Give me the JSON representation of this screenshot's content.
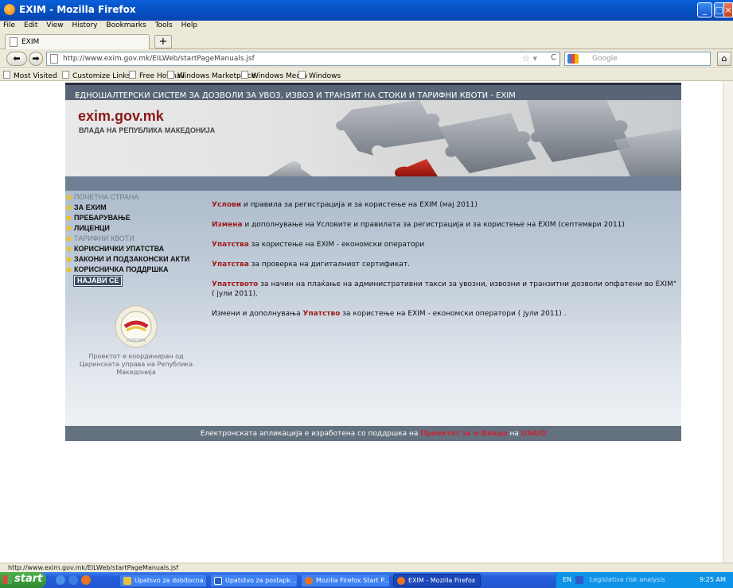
{
  "window": {
    "title": "EXIM - Mozilla Firefox"
  },
  "menu": [
    "File",
    "Edit",
    "View",
    "History",
    "Bookmarks",
    "Tools",
    "Help"
  ],
  "tab": {
    "label": "EXIM",
    "new_tab": "+"
  },
  "nav": {
    "url": "http://www.exim.gov.mk/EILWeb/startPageManuals.jsf",
    "search_placeholder": "Google"
  },
  "bookmarks": [
    "Most Visited",
    "Customize Links",
    "Free Hotmail",
    "Windows Marketplace",
    "Windows Media",
    "Windows"
  ],
  "site": {
    "top_title": "ЕДНОШАЛТЕРСКИ СИСТЕМ ЗА ДОЗВОЛИ ЗА УВОЗ, ИЗВОЗ И ТРАНЗИТ НА СТОКИ И ТАРИФНИ КВОТИ - EXIM",
    "logo": "exim.gov.mk",
    "logo_sub": "ВЛАДА НА РЕПУБЛИКА МАКЕДОНИЈА",
    "left_nav": [
      {
        "label": "ПОЧЕТНА СТРАНА",
        "style": "muted"
      },
      {
        "label": "ЗА ЕХИМ",
        "style": "dark"
      },
      {
        "label": "ПРЕБАРУВАЊЕ",
        "style": "dark"
      },
      {
        "label": "ЛИЦЕНЦИ",
        "style": "dark"
      },
      {
        "label": "ТАРИФНИ КВОТИ",
        "style": "muted"
      },
      {
        "label": "КОРИСНИЧКИ УПАТСТВА",
        "style": "dark"
      },
      {
        "label": "ЗАКОНИ И ПОДЗАКОНСКИ АКТИ",
        "style": "dark"
      },
      {
        "label": "КОРИСНИЧКА ПОДДРШКА",
        "style": "dark"
      }
    ],
    "login_label": "НАЈАВИ СЕ",
    "project_note": "Проектот е координиран од Царинската управа на Република Македонија",
    "content": [
      {
        "link": "Услови",
        "text": " и правила за регистрација и за користење на EXIM (мај 2011)"
      },
      {
        "link": "Измена",
        "text": " и дополнување на Условите и правилата за регистрација и за користење на EXIM (септември 2011)"
      },
      {
        "link": "Упатства",
        "text": " за користење на EXIM - економски оператори"
      },
      {
        "link": "Упатства",
        "text": " за проверка на дигиталниот сертификат."
      },
      {
        "link": "Упатството",
        "text": " за начин на плаќање на административни такси за увозни, извозни и транзитни дозволи опфатени во EXIM\" ( јули 2011)."
      },
      {
        "prefix": "Измени и дополнувања ",
        "link": "Упатство",
        "text": " за користење на EXIM - економски оператори ( јули 2011) ."
      }
    ],
    "footer_prefix": "Електронската апликација е изработена со поддршка на ",
    "footer_link1": "Проектот за е-Влада",
    "footer_mid": " на ",
    "footer_link2": "USAID"
  },
  "status_url": "http://www.exim.gov.mk/EILWeb/startPageManuals.jsf",
  "taskbar": {
    "start": "start",
    "tasks": [
      "Upatsvo za dobitocna...",
      "Upatstvo za postapk...",
      "Mozilla Firefox Start P...",
      "EXIM - Mozilla Firefox"
    ],
    "tray_lang": "EN",
    "tray_text": "Legislativa risk analysis",
    "clock": "9:25 AM"
  }
}
